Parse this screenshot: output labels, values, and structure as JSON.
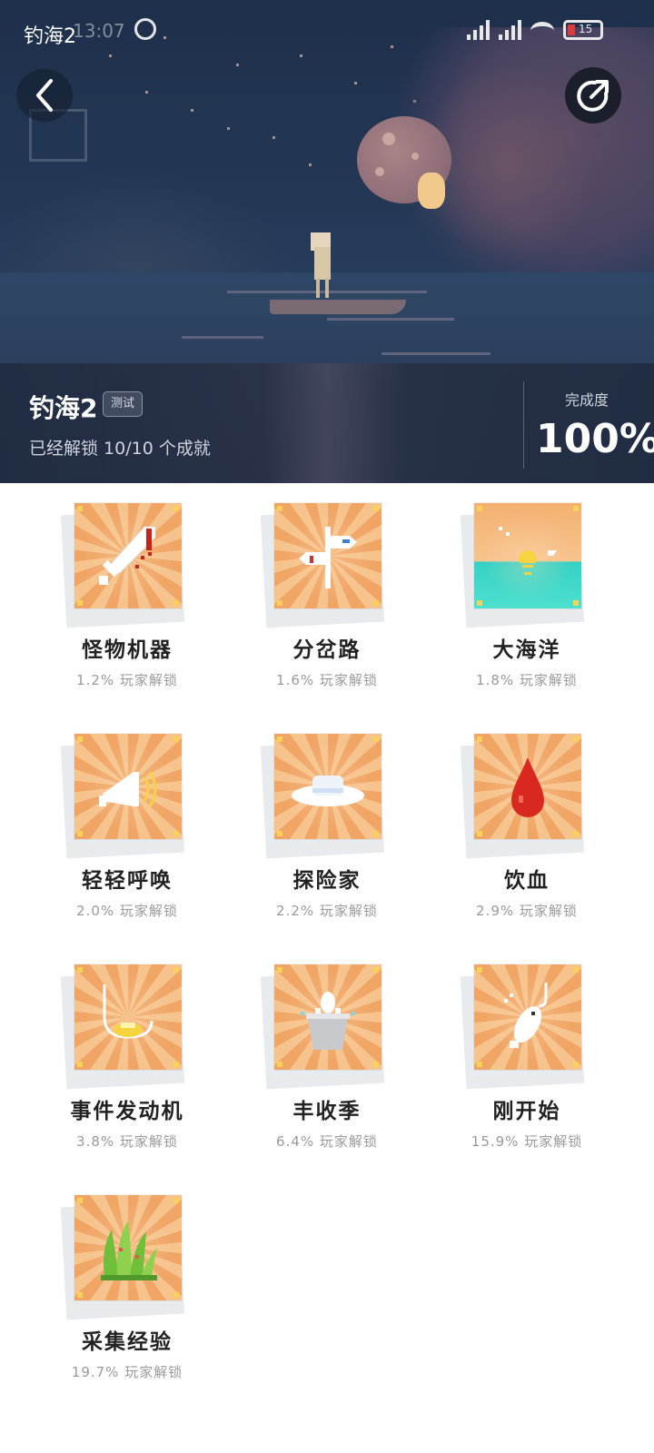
{
  "status_bar": {
    "app_name": "钓海2",
    "time": "13:07",
    "battery_text": "15"
  },
  "header": {
    "game_title": "钓海2",
    "tag": "测试",
    "unlock_summary": "已经解锁 10/10 个成就",
    "completion_label": "完成度",
    "completion_value": "100%"
  },
  "icons": {
    "back": "chevron-left-icon",
    "share": "share-icon",
    "alarm": "alarm-icon",
    "signal": "signal-icon",
    "wifi": "wifi-icon",
    "battery": "battery-icon"
  },
  "achievements": [
    {
      "name": "怪物机器",
      "rate": "1.2% 玩家解锁",
      "icon": "sword-icon"
    },
    {
      "name": "分岔路",
      "rate": "1.6% 玩家解锁",
      "icon": "signpost-icon"
    },
    {
      "name": "大海洋",
      "rate": "1.8% 玩家解锁",
      "icon": "sea-icon"
    },
    {
      "name": "轻轻呼唤",
      "rate": "2.0% 玩家解锁",
      "icon": "horn-icon"
    },
    {
      "name": "探险家",
      "rate": "2.2% 玩家解锁",
      "icon": "hat-icon"
    },
    {
      "name": "饮血",
      "rate": "2.9% 玩家解锁",
      "icon": "blood-drop-icon"
    },
    {
      "name": "事件发动机",
      "rate": "3.8% 玩家解锁",
      "icon": "hook-gold-icon"
    },
    {
      "name": "丰收季",
      "rate": "6.4% 玩家解锁",
      "icon": "bucket-icon"
    },
    {
      "name": "刚开始",
      "rate": "15.9% 玩家解锁",
      "icon": "fish-hook-icon"
    },
    {
      "name": "采集经验",
      "rate": "19.7% 玩家解锁",
      "icon": "seaweed-icon"
    }
  ],
  "colors": {
    "badge_orange": "#f0a565",
    "badge_light": "#f6c38d",
    "hero_bg": "#243957",
    "text_dark": "#222222",
    "text_muted": "#9a9a9a"
  }
}
